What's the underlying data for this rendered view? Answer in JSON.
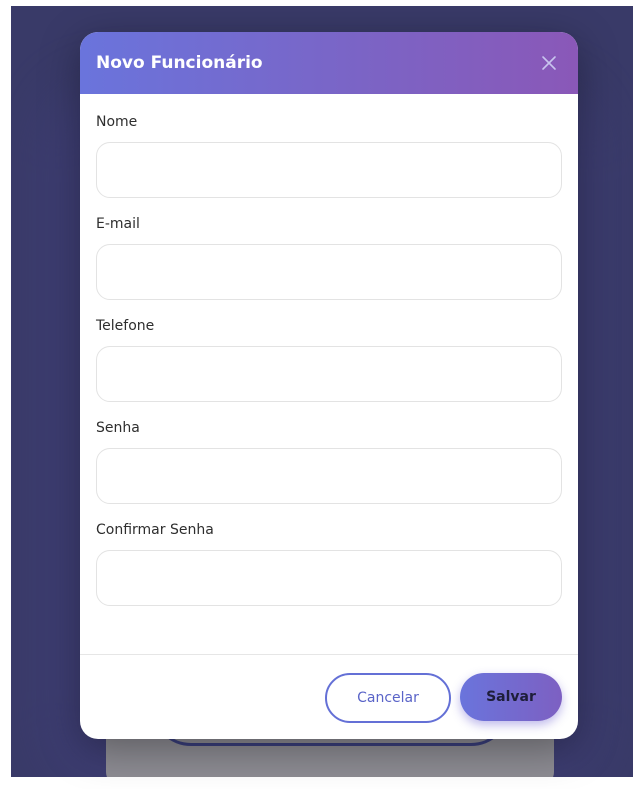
{
  "modal": {
    "title": "Novo Funcionário",
    "fields": [
      {
        "label": "Nome",
        "value": "",
        "placeholder": ""
      },
      {
        "label": "E-mail",
        "value": "",
        "placeholder": ""
      },
      {
        "label": "Telefone",
        "value": "",
        "placeholder": ""
      },
      {
        "label": "Senha",
        "value": "",
        "placeholder": ""
      },
      {
        "label": "Confirmar Senha",
        "value": "",
        "placeholder": ""
      }
    ],
    "cancel_label": "Cancelar",
    "save_label": "Salvar"
  },
  "icons": {
    "close": "close-icon"
  },
  "colors": {
    "accent": "#6a74dc",
    "accent_end": "#8a58b8",
    "backdrop": "#393a68"
  }
}
